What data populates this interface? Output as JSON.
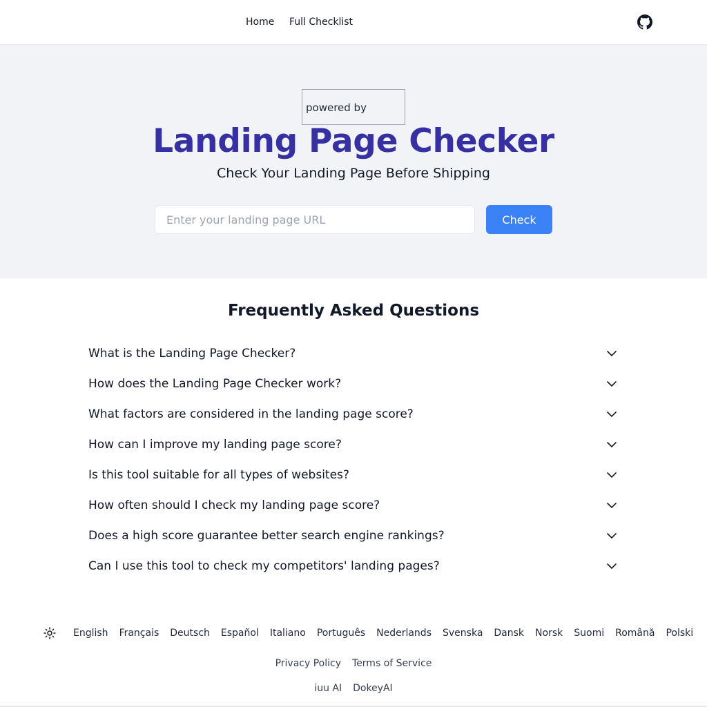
{
  "header": {
    "nav": [
      {
        "label": "Home"
      },
      {
        "label": "Full Checklist"
      }
    ],
    "github_icon": "github-icon"
  },
  "hero": {
    "powered_by": "powered by",
    "title": "Landing Page Checker",
    "subtitle": "Check Your Landing Page Before Shipping",
    "url_placeholder": "Enter your landing page URL",
    "url_value": "",
    "check_label": "Check",
    "accent_color": "#3730a3",
    "button_color": "#3b82f6"
  },
  "faq": {
    "title": "Frequently Asked Questions",
    "items": [
      {
        "question": "What is the Landing Page Checker?"
      },
      {
        "question": "How does the Landing Page Checker work?"
      },
      {
        "question": "What factors are considered in the landing page score?"
      },
      {
        "question": "How can I improve my landing page score?"
      },
      {
        "question": "Is this tool suitable for all types of websites?"
      },
      {
        "question": "How often should I check my landing page score?"
      },
      {
        "question": "Does a high score guarantee better search engine rankings?"
      },
      {
        "question": "Can I use this tool to check my competitors' landing pages?"
      }
    ],
    "chevron_icon": "chevron-down-icon"
  },
  "footer": {
    "theme_icon": "sun-icon",
    "languages": [
      "English",
      "Français",
      "Deutsch",
      "Español",
      "Italiano",
      "Português",
      "Nederlands",
      "Svenska",
      "Dansk",
      "Norsk",
      "Suomi",
      "Română",
      "Polski"
    ],
    "legal_links": [
      "Privacy Policy",
      "Terms of Service"
    ],
    "partner_links": [
      "iuu AI",
      "DokeyAI"
    ]
  }
}
